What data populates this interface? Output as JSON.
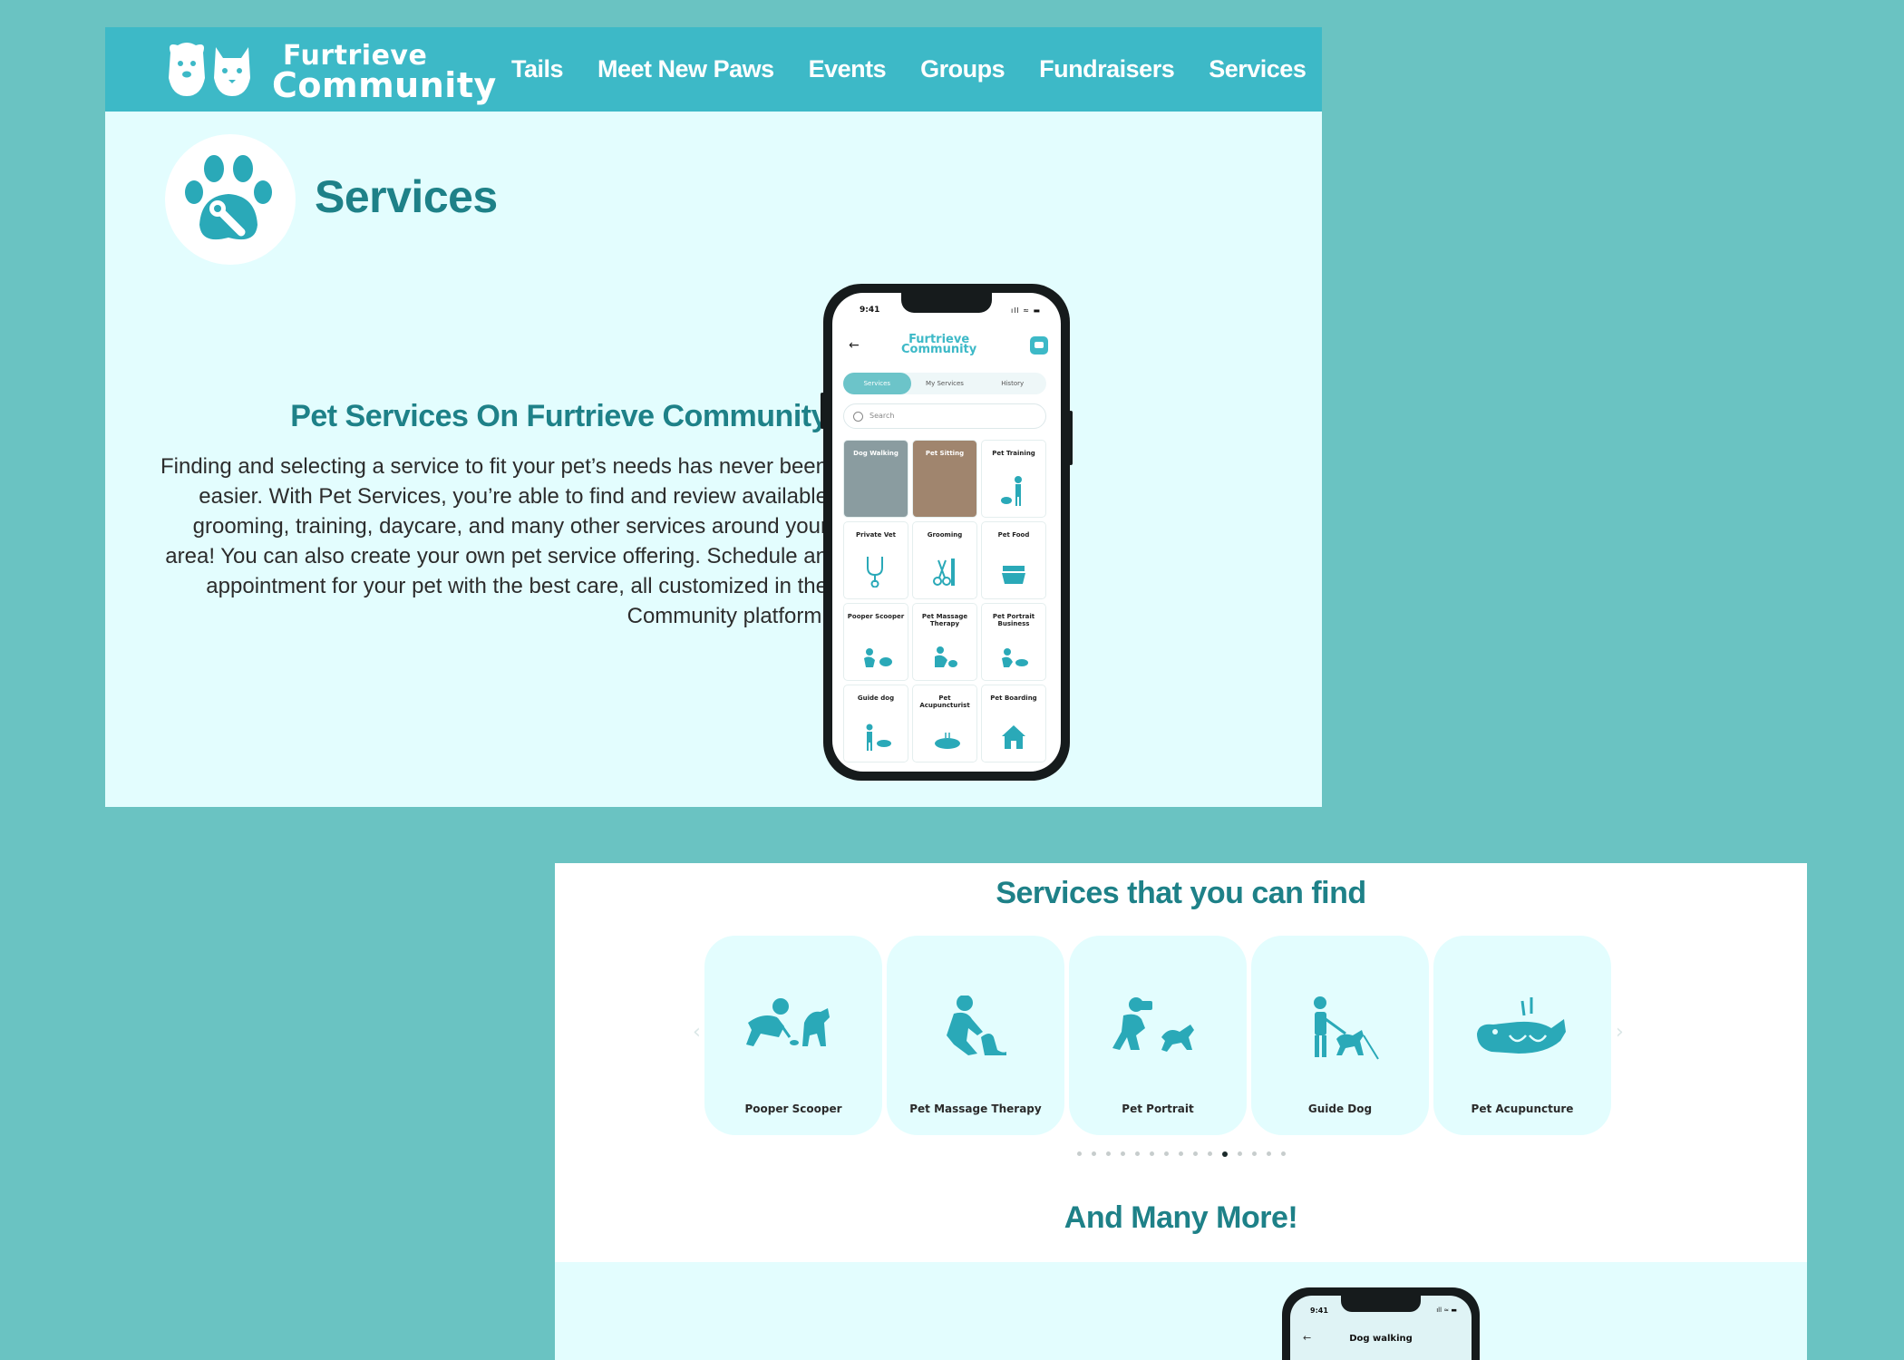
{
  "header": {
    "logo_line1": "Furtrieve",
    "logo_line2": "Community",
    "nav": [
      {
        "label": "Tails"
      },
      {
        "label": "Meet New Paws"
      },
      {
        "label": "Events"
      },
      {
        "label": "Groups"
      },
      {
        "label": "Fundraisers"
      },
      {
        "label": "Services"
      }
    ]
  },
  "page": {
    "title": "Services",
    "section_heading": "Pet Services On Furtrieve Community",
    "section_body": "Finding and selecting a service to fit your pet’s needs has never been easier. With Pet Services, you’re able to find and review available grooming, training, daycare, and many other services around your area! You can also create your own pet service offering. Schedule an appointment for your pet with the best care, all customized in the Community platform."
  },
  "phone": {
    "time": "9:41",
    "status": "ıll ≈ ▬",
    "back": "←",
    "logo_line1": "Furtrieve",
    "logo_line2": "Community",
    "tabs": [
      "Services",
      "My Services",
      "History"
    ],
    "search_placeholder": "Search",
    "tiles": [
      {
        "label": "Dog Walking"
      },
      {
        "label": "Pet Sitting"
      },
      {
        "label": "Pet Training"
      },
      {
        "label": "Private Vet"
      },
      {
        "label": "Grooming"
      },
      {
        "label": "Pet Food"
      },
      {
        "label": "Pooper Scooper"
      },
      {
        "label": "Pet Massage Therapy"
      },
      {
        "label": "Pet Portrait Business"
      },
      {
        "label": "Guide dog"
      },
      {
        "label": "Pet Acupuncturist"
      },
      {
        "label": "Pet Boarding"
      }
    ]
  },
  "services_section": {
    "title": "Services that you can find",
    "prev_arrow": "‹",
    "next_arrow": "›",
    "cards": [
      {
        "label": "Pooper Scooper",
        "icon": "pooper-scooper-icon"
      },
      {
        "label": "Pet Massage Therapy",
        "icon": "pet-massage-icon"
      },
      {
        "label": "Pet Portrait",
        "icon": "pet-portrait-icon"
      },
      {
        "label": "Guide Dog",
        "icon": "guide-dog-icon"
      },
      {
        "label": "Pet Acupuncture",
        "icon": "pet-acupuncture-icon"
      }
    ],
    "pagination": {
      "total": 15,
      "active": 10
    },
    "more_title": "And Many More!"
  },
  "phone2": {
    "time": "9:41",
    "status": "ıll ≈ ▬",
    "back": "←",
    "title": "Dog walking"
  },
  "colors": {
    "page_bg": "#6ac3c2",
    "nav_bg": "#3db9c7",
    "panel_bg": "#e3fdfe",
    "heading": "#1e8188",
    "icon_teal": "#2aa9b8"
  }
}
